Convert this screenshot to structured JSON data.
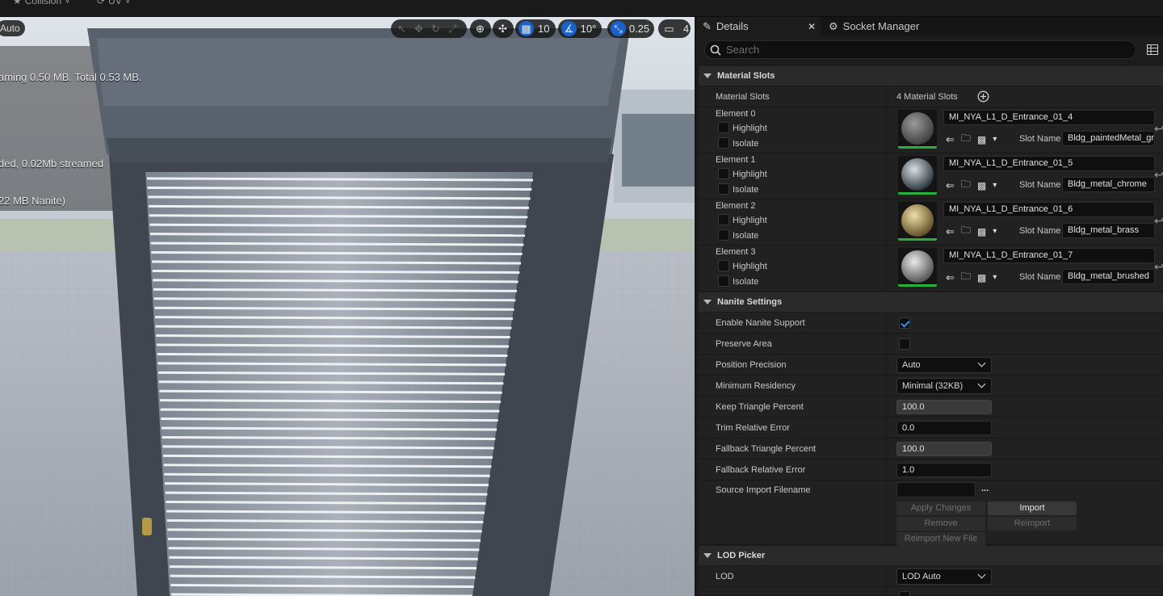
{
  "topbar": {
    "collision_label": "Collision",
    "uv_label": "UV"
  },
  "viewport": {
    "auto_label": "Auto",
    "stats": [
      "aming 0.50 MB. Total 0.53 MB.",
      "ded, 0.02Mb streamed",
      "22 MB Nanite)"
    ],
    "toolbar": {
      "grid_snap_value": "10",
      "rotation_snap_value": "10°",
      "scale_snap_value": "0.25",
      "camera_speed_value": "4"
    }
  },
  "panel": {
    "tabs": {
      "details": "Details",
      "socket_manager": "Socket Manager"
    },
    "search_placeholder": "Search",
    "material_slots": {
      "header": "Material Slots",
      "row_label": "Material Slots",
      "count_text": "4 Material Slots",
      "highlight_label": "Highlight",
      "isolate_label": "Isolate",
      "slot_name_label": "Slot Name",
      "elements": [
        {
          "label": "Element 0",
          "material": "MI_NYA_L1_D_Entrance_01_4",
          "slot": "Bldg_paintedMetal_grey",
          "thumb": "grey"
        },
        {
          "label": "Element 1",
          "material": "MI_NYA_L1_D_Entrance_01_5",
          "slot": "Bldg_metal_chrome",
          "thumb": "chrome"
        },
        {
          "label": "Element 2",
          "material": "MI_NYA_L1_D_Entrance_01_6",
          "slot": "Bldg_metal_brass",
          "thumb": "brass"
        },
        {
          "label": "Element 3",
          "material": "MI_NYA_L1_D_Entrance_01_7",
          "slot": "Bldg_metal_brushed",
          "thumb": "brushed"
        }
      ]
    },
    "nanite": {
      "header": "Nanite Settings",
      "enable_label": "Enable Nanite Support",
      "enable_checked": true,
      "preserve_label": "Preserve Area",
      "preserve_checked": false,
      "position_precision_label": "Position Precision",
      "position_precision_value": "Auto",
      "min_residency_label": "Minimum Residency",
      "min_residency_value": "Minimal (32KB)",
      "keep_triangle_label": "Keep Triangle Percent",
      "keep_triangle_value": "100.0",
      "trim_error_label": "Trim Relative Error",
      "trim_error_value": "0.0",
      "fallback_triangle_label": "Fallback Triangle Percent",
      "fallback_triangle_value": "100.0",
      "fallback_error_label": "Fallback Relative Error",
      "fallback_error_value": "1.0",
      "source_import_label": "Source Import Filename",
      "source_import_value": "",
      "more_label": "...",
      "buttons": {
        "apply_changes": "Apply Changes",
        "import": "Import",
        "remove": "Remove",
        "reimport": "Reimport",
        "reimport_new_file": "Reimport New File"
      }
    },
    "lod_picker": {
      "header": "LOD Picker",
      "lod_label": "LOD",
      "lod_value": "LOD Auto"
    }
  }
}
